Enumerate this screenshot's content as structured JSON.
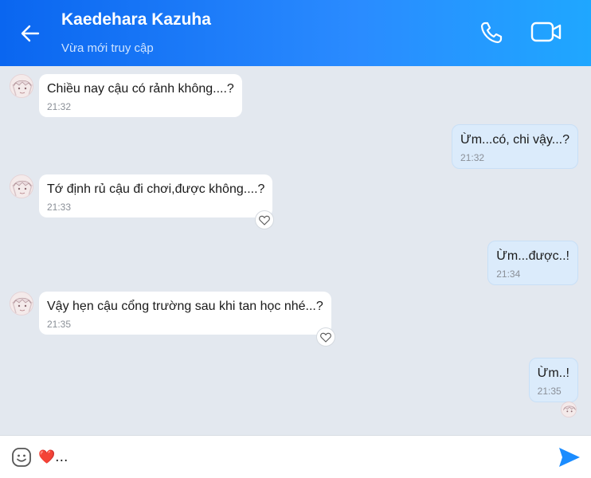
{
  "header": {
    "name": "Kaedehara Kazuha",
    "status": "Vừa mới truy cập",
    "icons": [
      "back-arrow-icon",
      "phone-icon",
      "video-call-icon"
    ]
  },
  "messages": [
    {
      "side": "in",
      "text": "Chiều nay cậu có rảnh không....?",
      "time": "21:32"
    },
    {
      "side": "out",
      "text": "Ừm...có, chi vậy...?",
      "time": "21:32"
    },
    {
      "side": "in",
      "text": "Tớ định rủ cậu đi chơi,được không....?",
      "time": "21:33"
    },
    {
      "side": "out",
      "text": "Ừm...được..!",
      "time": "21:34"
    },
    {
      "side": "in",
      "text": "Vậy hẹn cậu cổng trường sau khi tan học nhé...?",
      "time": "21:35"
    },
    {
      "side": "out",
      "text": "Ừm..!",
      "time": "21:35"
    }
  ],
  "composer": {
    "value": "❤️...",
    "icons": [
      "emoji-icon",
      "send-icon"
    ]
  },
  "colors": {
    "header_start": "#0a66f0",
    "header_end": "#1fa7ff",
    "chat_bg": "#e3e8ef",
    "outgoing_bubble": "#dbebfb",
    "send": "#1a8cff"
  }
}
